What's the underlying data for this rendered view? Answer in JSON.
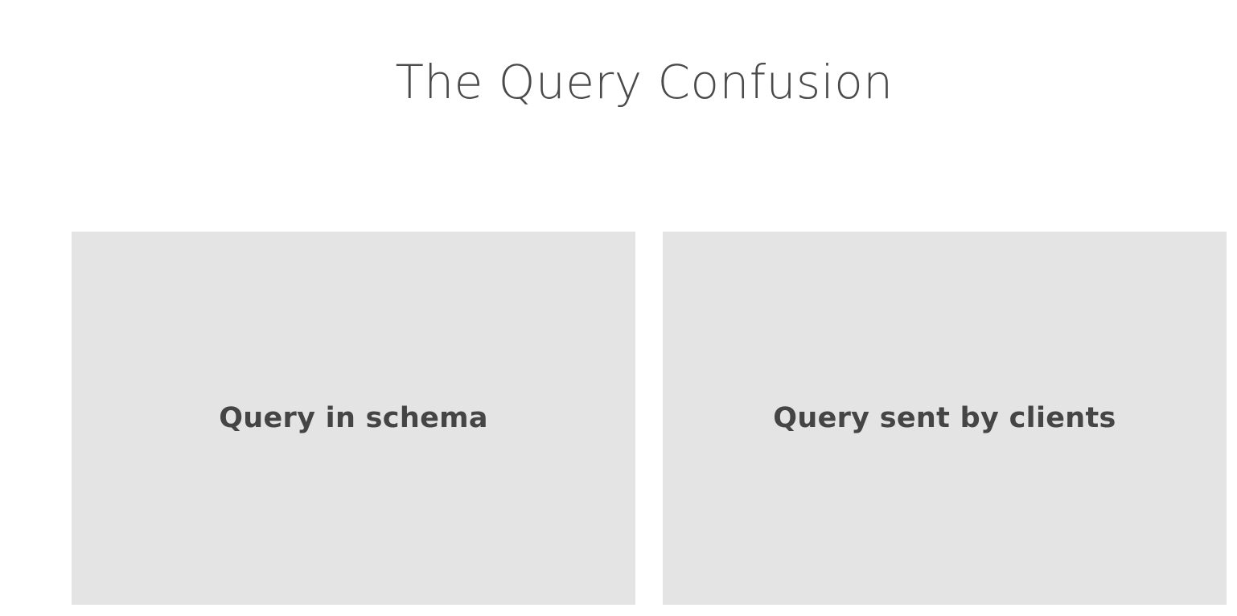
{
  "slide": {
    "title": "The Query Confusion"
  },
  "panels": [
    {
      "label": "Query in schema"
    },
    {
      "label": "Query sent by clients"
    }
  ],
  "colors": {
    "background": "#ffffff",
    "panel_fill": "#e4e4e4",
    "text": "#454545"
  }
}
